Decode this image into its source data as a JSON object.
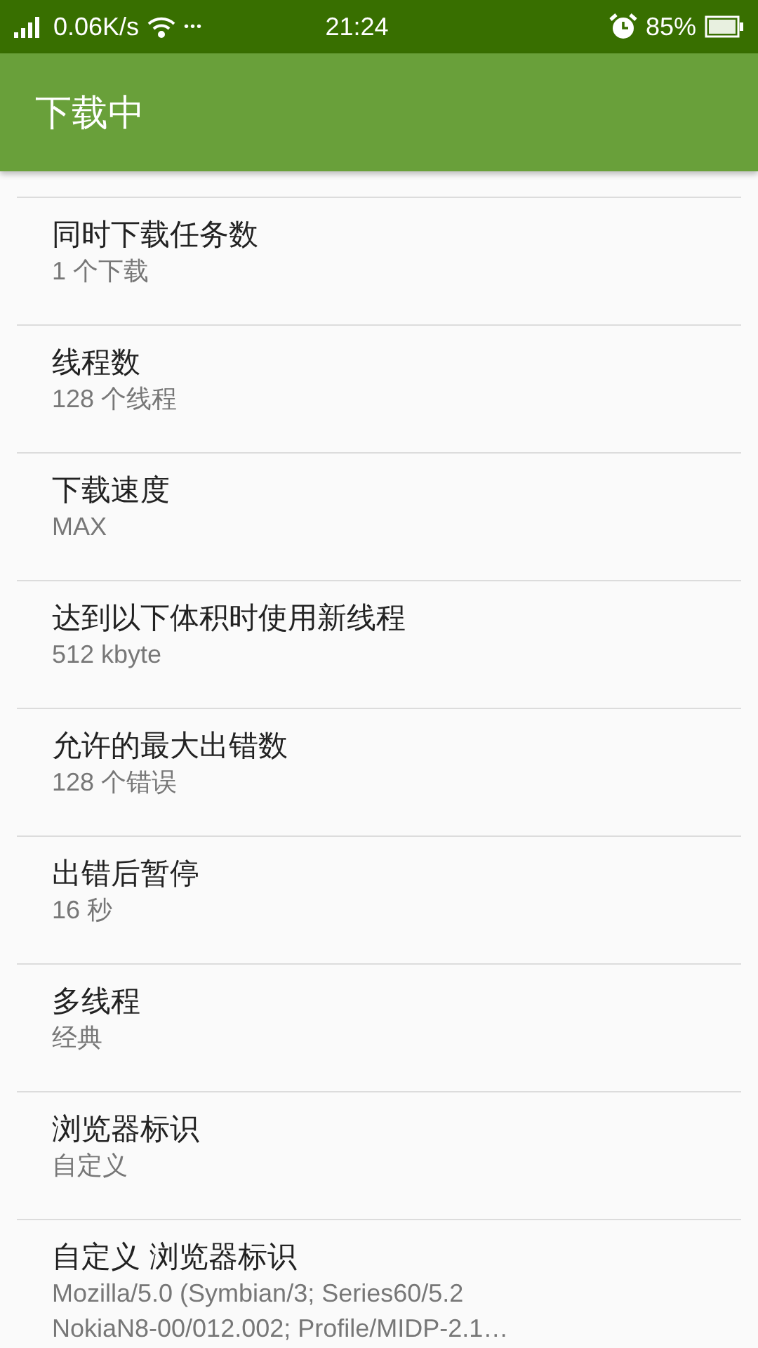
{
  "status_bar": {
    "net_speed": "0.06K/s",
    "more": "•••",
    "time": "21:24",
    "battery": "85%"
  },
  "app_bar": {
    "title": "下载中"
  },
  "settings": [
    {
      "title": "同时下载任务数",
      "summary": "1 个下载"
    },
    {
      "title": "线程数",
      "summary": "128 个线程"
    },
    {
      "title": "下载速度",
      "summary": "MAX"
    },
    {
      "title": "达到以下体积时使用新线程",
      "summary": "512 kbyte"
    },
    {
      "title": "允许的最大出错数",
      "summary": "128 个错误"
    },
    {
      "title": "出错后暂停",
      "summary": "16 秒"
    },
    {
      "title": "多线程",
      "summary": "经典"
    },
    {
      "title": "浏览器标识",
      "summary": "自定义"
    },
    {
      "title": "自定义 浏览器标识",
      "summary": "Mozilla/5.0 (Symbian/3; Series60/5.2 NokiaN8-00/012.002; Profile/MIDP-2.1…"
    }
  ]
}
